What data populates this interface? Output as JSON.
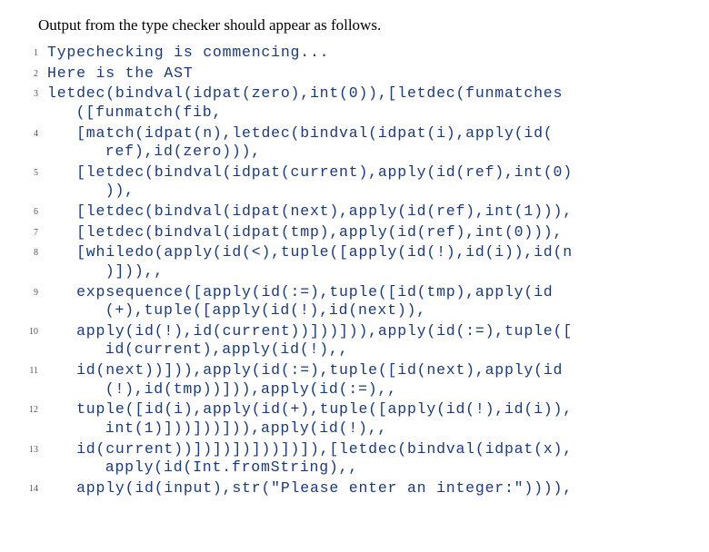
{
  "intro": "Output from the type checker should appear as follows.",
  "code": {
    "lines": [
      {
        "n": "1",
        "t": "Typechecking is commencing...",
        "w": ""
      },
      {
        "n": "2",
        "t": "Here is the AST",
        "w": ""
      },
      {
        "n": "3",
        "t": "letdec(bindval(idpat(zero),int(0)),[letdec(funmatches",
        "w": "([funmatch(fib,"
      },
      {
        "n": "4",
        "t": "   [match(idpat(n),letdec(bindval(idpat(i),apply(id(",
        "w": "   ref),id(zero))),"
      },
      {
        "n": "5",
        "t": "   [letdec(bindval(idpat(current),apply(id(ref),int(0)",
        "w": "   )),"
      },
      {
        "n": "6",
        "t": "   [letdec(bindval(idpat(next),apply(id(ref),int(1))),",
        "w": ""
      },
      {
        "n": "7",
        "t": "   [letdec(bindval(idpat(tmp),apply(id(ref),int(0))),",
        "w": ""
      },
      {
        "n": "8",
        "t": "   [whiledo(apply(id(<),tuple([apply(id(!),id(i)),id(n",
        "w": "   )])),,"
      },
      {
        "n": "9",
        "t": "   expsequence([apply(id(:=),tuple([id(tmp),apply(id",
        "w": "   (+),tuple([apply(id(!),id(next)),"
      },
      {
        "n": "10",
        "t": "   apply(id(!),id(current))]))])),apply(id(:=),tuple([",
        "w": "   id(current),apply(id(!),,"
      },
      {
        "n": "11",
        "t": "   id(next))])),apply(id(:=),tuple([id(next),apply(id",
        "w": "   (!),id(tmp))])),apply(id(:=),,"
      },
      {
        "n": "12",
        "t": "   tuple([id(i),apply(id(+),tuple([apply(id(!),id(i)),",
        "w": "   int(1)]))]))])),apply(id(!),,"
      },
      {
        "n": "13",
        "t": "   id(current))])])])]))])]),[letdec(bindval(idpat(x),",
        "w": "   apply(id(Int.fromString),,"
      },
      {
        "n": "14",
        "t": "   apply(id(input),str(\"Please enter an integer:\")))),",
        "w": ""
      }
    ]
  }
}
